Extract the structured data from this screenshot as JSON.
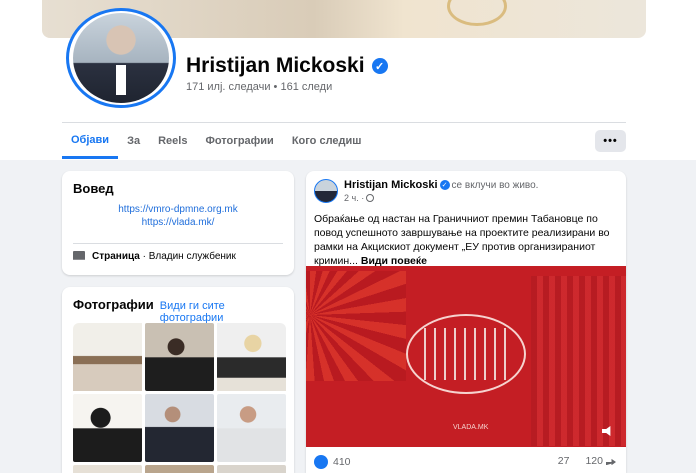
{
  "profile": {
    "name": "Hristijan Mickoski",
    "followers": "171 илј. следачи • 161 следи"
  },
  "tabs": [
    {
      "label": "Објави",
      "active": true
    },
    {
      "label": "За"
    },
    {
      "label": "Reels"
    },
    {
      "label": "Фотографии"
    },
    {
      "label": "Кого следиш"
    }
  ],
  "more_label": "•••",
  "intro": {
    "title": "Вовед",
    "links": [
      "https://vmro-dpmne.org.mk",
      "https://vlada.mk/"
    ],
    "page_label": "Страница",
    "page_category": " · Владин службеник"
  },
  "photos": {
    "title": "Фотографии",
    "see_all": "Види ги сите фотографии"
  },
  "post": {
    "author": "Hristijan Mickoski",
    "status": "се вклучи во живо.",
    "time": "2 ч. ·",
    "text": "Обраќање од настан на Граничниот премин Табановце по повод успешното завршување на проектите реализирани во рамки на Акцискиот документ „ЕУ против организираниот кримин...",
    "see_more": "Види повеќе",
    "image_watermark": "VLADA.MK",
    "reactions_count": "410",
    "comments_count": "27",
    "shares_count": "120"
  },
  "colors": {
    "accent": "#1877f2",
    "post_image_red": "#c41e24"
  }
}
